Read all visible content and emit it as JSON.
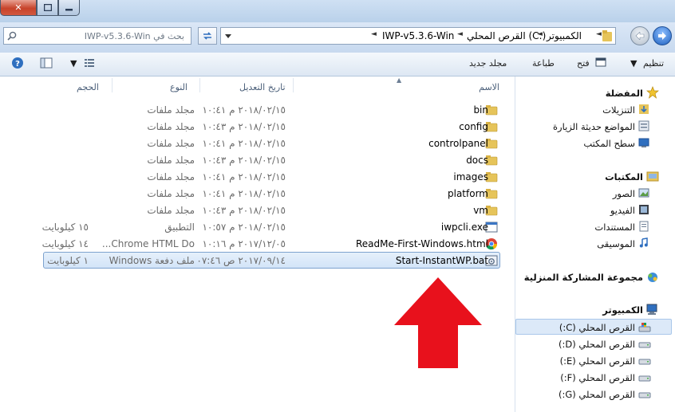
{
  "window": {
    "close_label": "✕"
  },
  "address_bar": {
    "search_placeholder": "بحث في IWP-v5.3.6-Win",
    "crumbs": [
      "الكمبيوتر",
      "القرص المحلي (C:)",
      "IWP-v5.3.6-Win"
    ]
  },
  "toolbar": {
    "organize": "تنظيم",
    "open": "فتح",
    "print": "طباعة",
    "new_folder": "مجلد جديد"
  },
  "columns": {
    "name": "الاسم",
    "date": "تاريخ التعديل",
    "type": "النوع",
    "size": "الحجم"
  },
  "files": [
    {
      "name": "bin",
      "date": "٢٠١٨/٠٢/١٥ م ١٠:٤١",
      "type": "مجلد ملفات",
      "size": "",
      "icon": "folder-icon"
    },
    {
      "name": "config",
      "date": "٢٠١٨/٠٢/١٥ م ١٠:٤٣",
      "type": "مجلد ملفات",
      "size": "",
      "icon": "folder-icon"
    },
    {
      "name": "controlpanel",
      "date": "٢٠١٨/٠٢/١٥ م ١٠:٤١",
      "type": "مجلد ملفات",
      "size": "",
      "icon": "folder-icon"
    },
    {
      "name": "docs",
      "date": "٢٠١٨/٠٢/١٥ م ١٠:٤٣",
      "type": "مجلد ملفات",
      "size": "",
      "icon": "folder-icon"
    },
    {
      "name": "images",
      "date": "٢٠١٨/٠٢/١٥ م ١٠:٤١",
      "type": "مجلد ملفات",
      "size": "",
      "icon": "folder-icon"
    },
    {
      "name": "platform",
      "date": "٢٠١٨/٠٢/١٥ م ١٠:٤١",
      "type": "مجلد ملفات",
      "size": "",
      "icon": "folder-icon"
    },
    {
      "name": "vm",
      "date": "٢٠١٨/٠٢/١٥ م ١٠:٤٣",
      "type": "مجلد ملفات",
      "size": "",
      "icon": "folder-icon"
    },
    {
      "name": "iwpcli.exe",
      "date": "٢٠١٨/٠٢/١٥ م ١٠:٥٧",
      "type": "التطبيق",
      "size": "١٥ كيلوبايت",
      "icon": "exe-icon"
    },
    {
      "name": "ReadMe-First-Windows.html",
      "date": "٢٠١٧/١٢/٠٥ م ١٠:١٦",
      "type": "Chrome HTML Do...",
      "size": "١٤ كيلوبايت",
      "icon": "chrome-icon"
    },
    {
      "name": "Start-InstantWP.bat",
      "date": "٢٠١٧/٠٩/١٤ ص ٠٧:٤٦",
      "type": "ملف دفعة Windows",
      "size": "١ كيلوبايت",
      "icon": "bat-icon",
      "selected": true
    }
  ],
  "nav": {
    "favorites": "المفضلة",
    "downloads": "التنزيلات",
    "recent": "المواضع حديثة الزيارة",
    "desktop": "سطح المكتب",
    "libraries": "المكتبات",
    "pictures": "الصور",
    "videos": "الفيديو",
    "documents": "المستندات",
    "music": "الموسيقى",
    "homegroup": "مجموعة المشاركة المنزلية",
    "computer": "الكمبيوتر",
    "drives": [
      "القرص المحلي (C:)",
      "القرص المحلي (D:)",
      "القرص المحلي (E:)",
      "القرص المحلي (F:)",
      "القرص المحلي (G:)"
    ]
  },
  "colors": {
    "accent": "#3b76c4",
    "selection": "#d3e4f8",
    "arrow": "#e8111c"
  }
}
